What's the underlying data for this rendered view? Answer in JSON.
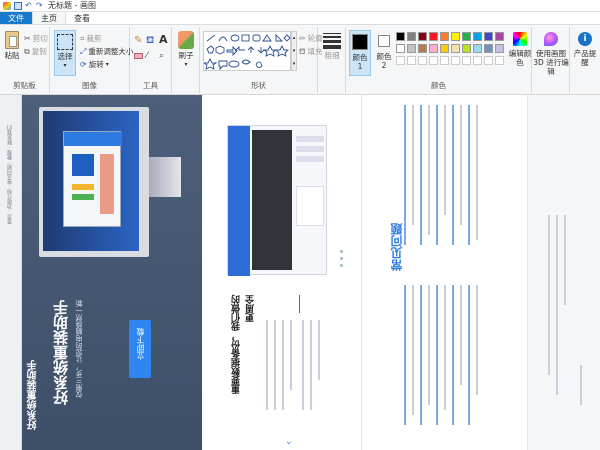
{
  "window": {
    "title": "无标题 - 画图"
  },
  "tabs": [
    "文件",
    "主页",
    "查看"
  ],
  "ribbon": {
    "clipboard": {
      "label": "剪贴板",
      "paste": "粘贴",
      "cut": "剪切",
      "copy": "复制"
    },
    "image": {
      "label": "图像",
      "select": "选择",
      "crop": "裁剪",
      "resize": "重新调整大小",
      "rotate": "旋转"
    },
    "tools": {
      "label": "工具"
    },
    "brush": {
      "label": "刷子"
    },
    "shapes": {
      "label": "形状",
      "outline": "轮廓",
      "fill": "填充"
    },
    "size": {
      "label": "粗细"
    },
    "colors": {
      "label": "颜色",
      "color1": "颜色 1",
      "color2": "颜色 2",
      "edit": "编辑颜色"
    },
    "paint3d": {
      "label": "使用画图 3D 进行编辑"
    },
    "tips": {
      "label": "产品提醒"
    }
  },
  "palette": [
    "#000000",
    "#7f7f7f",
    "#880015",
    "#ed1c24",
    "#ff7f27",
    "#fff200",
    "#22b14c",
    "#00a2e8",
    "#3f48cc",
    "#a349a4",
    "#ffffff",
    "#c3c3c3",
    "#b97a57",
    "#ffaec9",
    "#ffc90e",
    "#efe4b0",
    "#b5e61d",
    "#99d9ea",
    "#7092be",
    "#c8bfe7",
    "#ffffff",
    "#ffffff",
    "#ffffff",
    "#ffffff",
    "#ffffff",
    "#ffffff",
    "#ffffff",
    "#ffffff",
    "#ffffff",
    "#ffffff"
  ],
  "canvas": {
    "p1": {
      "brand": "好系统重装助手",
      "headline": "好系统重装助手",
      "sub": "仅需三步，让您的电脑焕然一新",
      "download": "立即下载"
    },
    "p2": {
      "title1": "重要数据备份，我们做的",
      "title2": "更周全"
    },
    "p3": {
      "faq": "常见问题"
    }
  }
}
